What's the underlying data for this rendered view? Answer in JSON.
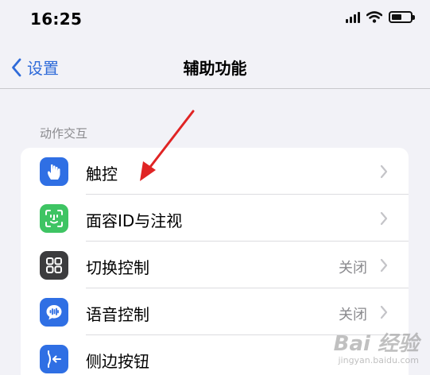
{
  "status_bar": {
    "time": "16:25",
    "battery_level": 0.55
  },
  "nav": {
    "back_label": "设置",
    "title": "辅助功能"
  },
  "section": {
    "header": "动作交互",
    "rows": [
      {
        "label": "触控",
        "value": "",
        "icon": "touch-icon",
        "icon_color": "#2f6fe4"
      },
      {
        "label": "面容ID与注视",
        "value": "",
        "icon": "face-id-icon",
        "icon_color": "#3ec463"
      },
      {
        "label": "切换控制",
        "value": "关闭",
        "icon": "switch-control-icon",
        "icon_color": "#3c3c3e"
      },
      {
        "label": "语音控制",
        "value": "关闭",
        "icon": "voice-control-icon",
        "icon_color": "#2f6fe4"
      },
      {
        "label": "侧边按钮",
        "value": "",
        "icon": "side-button-icon",
        "icon_color": "#2f6fe4"
      }
    ]
  },
  "colors": {
    "accent": "#2f6bd9",
    "annotation_arrow": "#e02424"
  },
  "watermark": {
    "brand": "Bai 经验",
    "url": "jingyan.baidu.com"
  }
}
